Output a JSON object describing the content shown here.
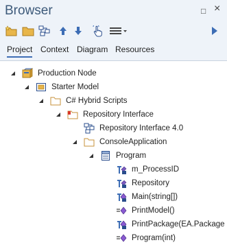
{
  "window": {
    "title": "Browser",
    "pin_glyph": "□",
    "close_glyph": "×"
  },
  "toolbar": {
    "buttons": [
      {
        "icon": "new-package-icon"
      },
      {
        "icon": "folder-icon"
      },
      {
        "icon": "diagram-icon"
      },
      {
        "icon": "move-up-icon"
      },
      {
        "icon": "move-down-icon"
      },
      {
        "icon": "hand-pointer-icon"
      },
      {
        "icon": "menu-icon"
      },
      {
        "icon": "play-arrow-icon"
      }
    ]
  },
  "tabs": [
    {
      "label": "Project",
      "active": true
    },
    {
      "label": "Context",
      "active": false
    },
    {
      "label": "Diagram",
      "active": false
    },
    {
      "label": "Resources",
      "active": false
    }
  ],
  "tree": {
    "nodes": [
      {
        "label": "Production Node",
        "icon": "node-icon",
        "depth": 0,
        "expanded": true
      },
      {
        "label": "Starter Model",
        "icon": "model-icon",
        "depth": 1,
        "expanded": true
      },
      {
        "label": "C# Hybrid Scripts",
        "icon": "package-folder-icon",
        "depth": 2,
        "expanded": true
      },
      {
        "label": "Repository Interface",
        "icon": "package-folder-red-icon",
        "depth": 3,
        "expanded": true
      },
      {
        "label": "Repository Interface 4.0",
        "icon": "diagram-icon",
        "depth": 4,
        "expanded": null
      },
      {
        "label": "ConsoleApplication",
        "icon": "package-folder-icon",
        "depth": 4,
        "expanded": true
      },
      {
        "label": "Program",
        "icon": "class-icon",
        "depth": 5,
        "expanded": true
      },
      {
        "label": "m_ProcessID",
        "icon": "attribute-icon",
        "depth": 6,
        "expanded": null
      },
      {
        "label": "Repository",
        "icon": "attribute-icon",
        "depth": 6,
        "expanded": null
      },
      {
        "label": "Main(string[])",
        "icon": "operation-private-icon",
        "depth": 6,
        "expanded": null
      },
      {
        "label": "PrintModel()",
        "icon": "operation-icon",
        "depth": 6,
        "expanded": null
      },
      {
        "label": "PrintPackage(EA.Package",
        "icon": "operation-private-icon",
        "depth": 6,
        "expanded": null
      },
      {
        "label": "Program(int)",
        "icon": "operation-icon",
        "depth": 6,
        "expanded": null
      }
    ]
  },
  "colors": {
    "title": "#3d5a7a",
    "header_bg": "#eef3f9",
    "accent": "#3d6db5",
    "folder": "#e8b64a"
  }
}
